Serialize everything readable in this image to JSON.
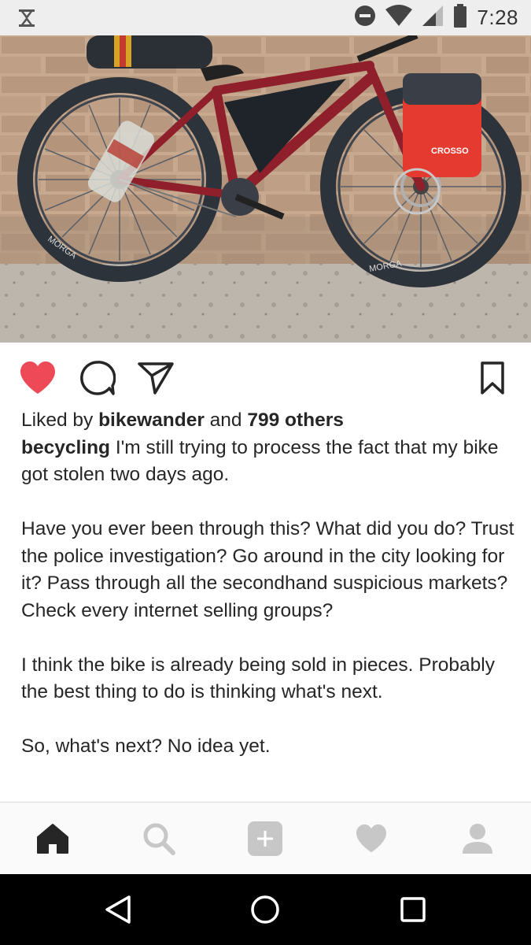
{
  "status_bar": {
    "time": "7:28",
    "icons": [
      "hourglass-icon",
      "do-not-disturb-icon",
      "wifi-icon",
      "signal-icon",
      "battery-icon"
    ]
  },
  "post": {
    "likes": {
      "prefix": "Liked by ",
      "user": "bikewander",
      "middle": " and ",
      "others": "799 others"
    },
    "caption": {
      "username": "becycling",
      "first_line": " I'm still trying to process the fact that my bike got stolen two days ago.",
      "paragraph_2": "Have you ever been through this? What did you do? Trust the police investigation? Go around in the city looking for it? Pass through all the secondhand suspicious markets? Check every internet selling groups?",
      "paragraph_3": "I think the bike is already being sold in pieces. Probably the best thing to do is thinking what's next.",
      "paragraph_4": "So, what's next? No idea yet."
    },
    "image_text": {
      "pannier_brand": "CROSSO",
      "tire_brand_rear": "MORGA",
      "tire_brand_front": "MORGA"
    },
    "liked": true
  },
  "actions": [
    "heart-icon",
    "comment-icon",
    "share-icon",
    "bookmark-icon"
  ],
  "bottom_nav": [
    "home-icon",
    "search-icon",
    "add-post-icon",
    "activity-heart-icon",
    "profile-icon"
  ],
  "android_nav": [
    "back-icon",
    "home-circle-icon",
    "recents-icon"
  ],
  "colors": {
    "like_red": "#ed4956",
    "text": "#262626",
    "icon_gray": "#c7c7c7",
    "status_bg": "#eeeeee",
    "bike_frame": "#8e1f2b",
    "pannier_red": "#e53a2f"
  }
}
